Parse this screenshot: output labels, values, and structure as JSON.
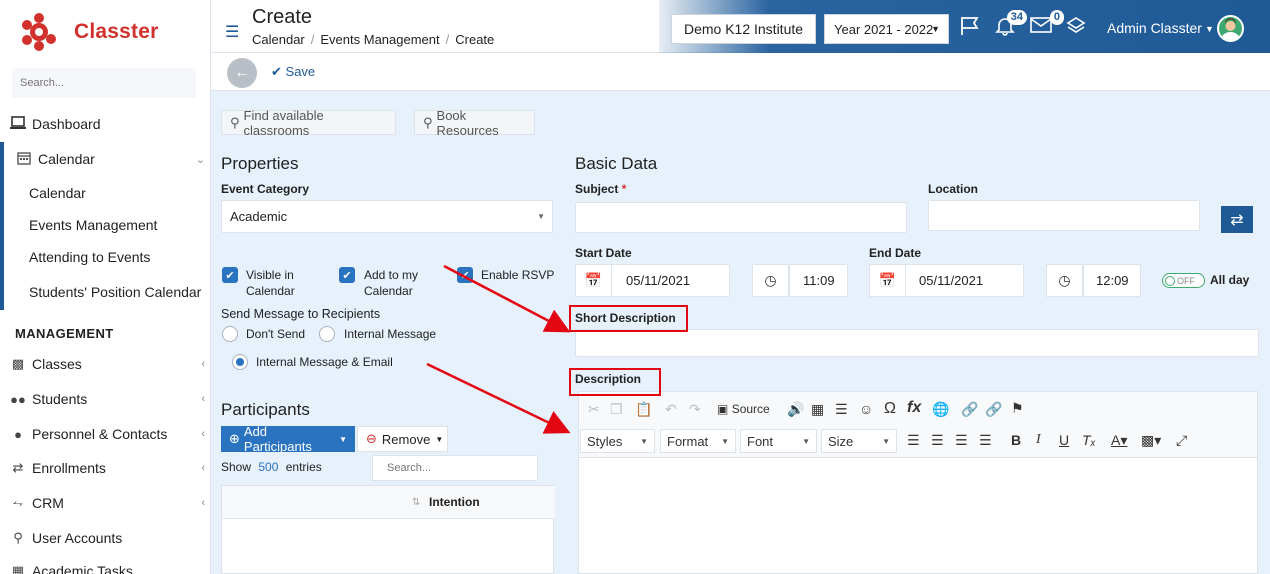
{
  "app": {
    "name": "Classter"
  },
  "sidebar": {
    "search_placeholder": "Search...",
    "items": [
      {
        "label": "Dashboard",
        "icon": "laptop-icon"
      },
      {
        "label": "Calendar",
        "icon": "calendar-icon"
      }
    ],
    "calendar_sub": [
      "Calendar",
      "Events Management",
      "Attending to Events",
      "Students' Position Calendar"
    ],
    "management_heading": "MANAGEMENT",
    "management_items": [
      {
        "label": "Classes",
        "icon": "classes-icon"
      },
      {
        "label": "Students",
        "icon": "students-icon"
      },
      {
        "label": "Personnel & Contacts",
        "icon": "person-icon"
      },
      {
        "label": "Enrollments",
        "icon": "swap-icon"
      },
      {
        "label": "CRM",
        "icon": "crm-icon"
      },
      {
        "label": "User Accounts",
        "icon": "key-icon"
      },
      {
        "label": "Academic Tasks",
        "icon": "grid-icon"
      }
    ]
  },
  "header": {
    "title": "Create",
    "breadcrumbs": [
      "Calendar",
      "Events Management",
      "Create"
    ],
    "institute": "Demo K12 Institute",
    "year": "Year 2021 - 2022",
    "notifications_count": "34",
    "messages_count": "0",
    "user_name": "Admin Classter"
  },
  "actions": {
    "save": "Save"
  },
  "tools": {
    "find_classrooms": "Find available classrooms",
    "book_resources": "Book Resources"
  },
  "properties": {
    "title": "Properties",
    "event_category_label": "Event Category",
    "event_category_value": "Academic",
    "checkboxes": [
      "Visible in Calendar",
      "Add to my Calendar",
      "Enable RSVP"
    ],
    "send_message_label": "Send Message to Recipients",
    "radios": [
      "Don't Send",
      "Internal Message",
      "Internal Message & Email"
    ]
  },
  "participants": {
    "title": "Participants",
    "add": "Add Participants",
    "remove": "Remove",
    "show": "Show",
    "entries_count": "500",
    "entries": "entries",
    "search_placeholder": "Search...",
    "col_intention": "Intention"
  },
  "basic": {
    "title": "Basic Data",
    "subject_label": "Subject",
    "location_label": "Location",
    "start_date_label": "Start Date",
    "start_date": "05/11/2021",
    "start_time": "11:09",
    "end_date_label": "End Date",
    "end_date": "05/11/2021",
    "end_time": "12:09",
    "toggle": "OFF",
    "all_day": "All day",
    "short_desc_label": "Short Description",
    "desc_label": "Description"
  },
  "editor": {
    "source": "Source",
    "styles": "Styles",
    "format": "Format",
    "font": "Font",
    "size": "Size"
  },
  "colors": {
    "brand": "#1f5a96",
    "accent": "#2a73c0",
    "logo_red": "#d2322d",
    "annotation": "#e30613"
  }
}
